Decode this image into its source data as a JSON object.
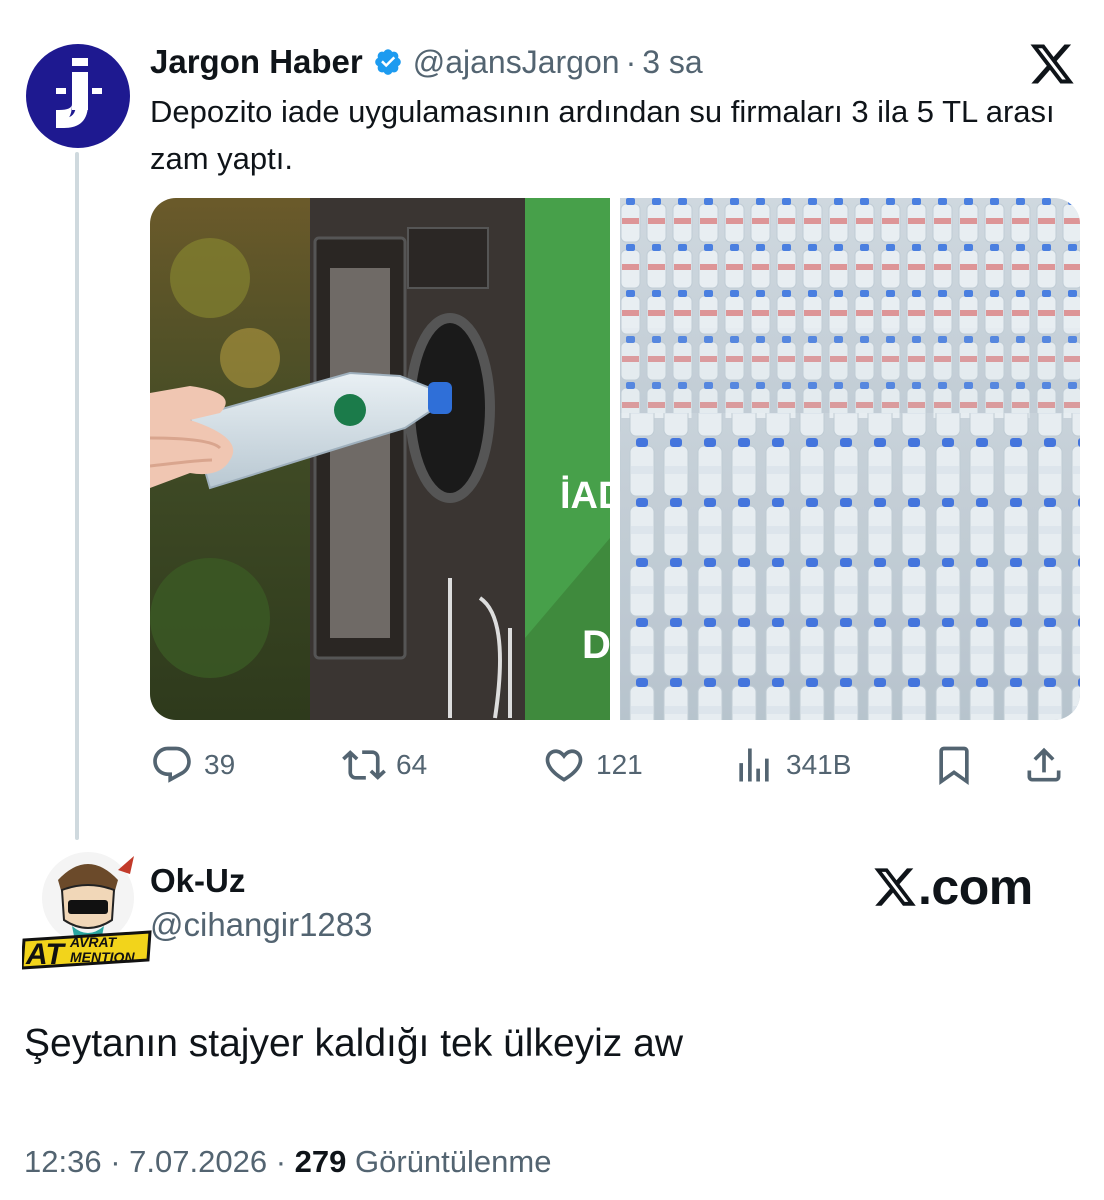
{
  "quoted_tweet": {
    "avatar_letter": "J",
    "display_name": "Jargon Haber",
    "handle": "@ajansJargon",
    "separator": "·",
    "time_ago": "3 sa",
    "text": "Depozito iade uygulamasının ardından su firmaları 3 ila 5 TL arası zam yaptı.",
    "media": {
      "left_image_text": "İAD",
      "left_image_text_2": "D"
    },
    "actions": {
      "replies": "39",
      "retweets": "64",
      "likes": "121",
      "views": "341B"
    }
  },
  "reply": {
    "display_name": "Ok-Uz",
    "handle": "@cihangir1283",
    "avatar_badge_line1": "AT",
    "avatar_badge_line2": "AVRAT",
    "avatar_badge_line3": "MENTION",
    "text": "Şeytanın stajyer kaldığı tek ülkeyiz aw"
  },
  "branding": {
    "site": ".com"
  },
  "footer": {
    "time": "12:36",
    "date": "7.07.2026",
    "views_count": "279",
    "views_label": "Görüntülenme",
    "dot": "·"
  },
  "colors": {
    "accent": "#1d9bf0",
    "muted": "#536471",
    "avatar_bg": "#1e1990",
    "line": "#cfd9de"
  }
}
